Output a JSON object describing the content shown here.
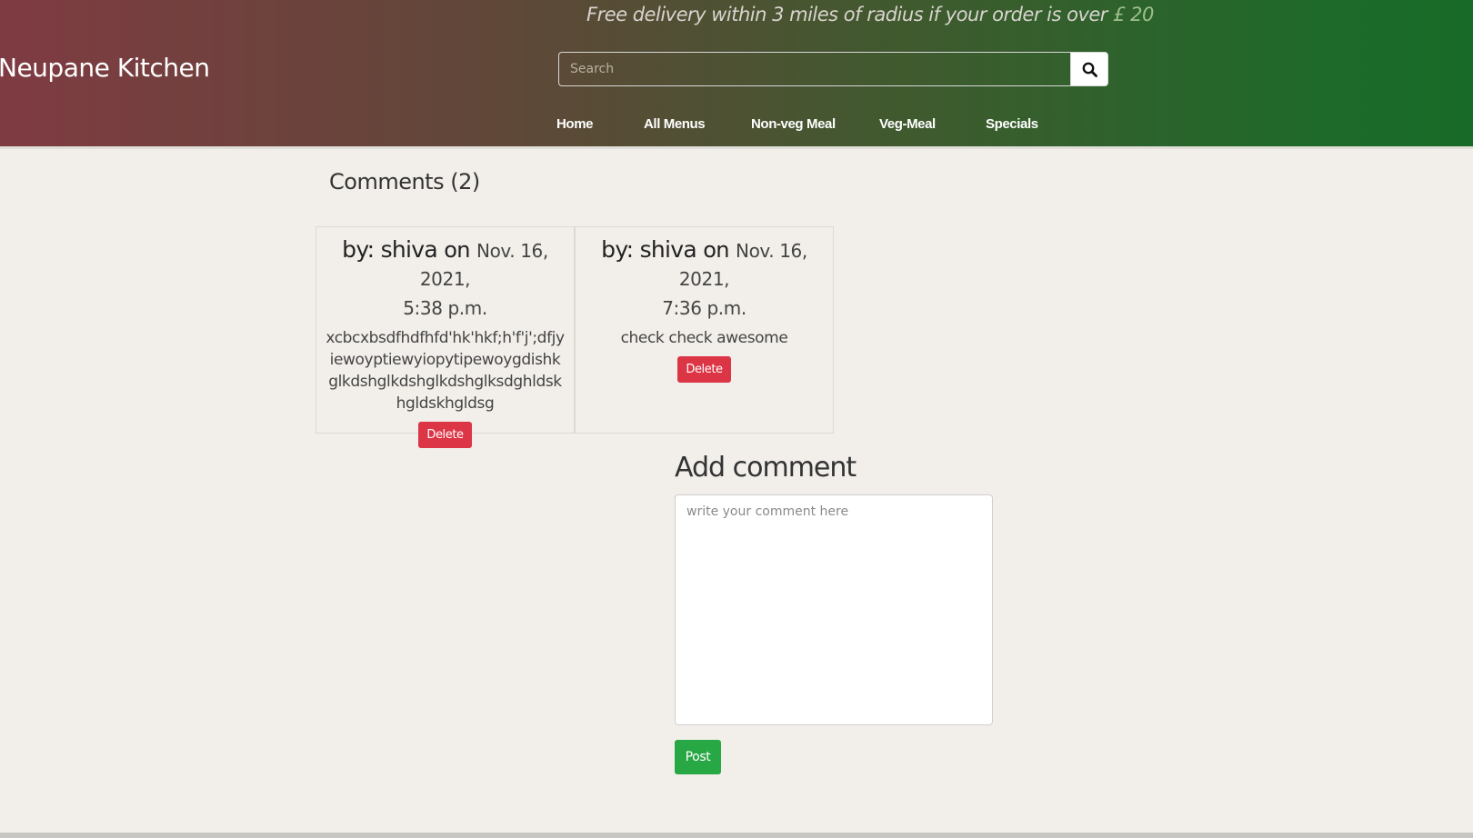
{
  "header": {
    "promo_text": "Free delivery within 3 miles of radius if your order is over ",
    "promo_amount": "£ 20",
    "brand": "Neupane Kitchen",
    "search": {
      "placeholder": "Search",
      "button_icon": "search-icon"
    },
    "nav": [
      {
        "label": "Home"
      },
      {
        "label": "All Menus"
      },
      {
        "label": "Non-veg Meal"
      },
      {
        "label": "Veg-Meal"
      },
      {
        "label": "Specials"
      }
    ]
  },
  "comments": {
    "title": "Comments (2)",
    "items": [
      {
        "by_label": "by: shiva",
        "on_label": "on",
        "date": "Nov. 16, 2021,",
        "time": "5:38 p.m.",
        "body": "xcbcxbsdfhdfhfd'hk'hkf;h'f'j';dfjyiewoyptiewyiopytipewoygdishkglkdshglkdshglkdshglksdghldskhgldskhgldsg",
        "delete_label": "Delete"
      },
      {
        "by_label": "by: shiva",
        "on_label": "on",
        "date": "Nov. 16, 2021,",
        "time": "7:36 p.m.",
        "body": "check check awesome",
        "delete_label": "Delete"
      }
    ]
  },
  "add_comment": {
    "title": "Add comment",
    "placeholder": "write your comment here",
    "post_label": "Post"
  },
  "colors": {
    "delete": "#dc3545",
    "post": "#28a745",
    "background": "#f2efea"
  }
}
